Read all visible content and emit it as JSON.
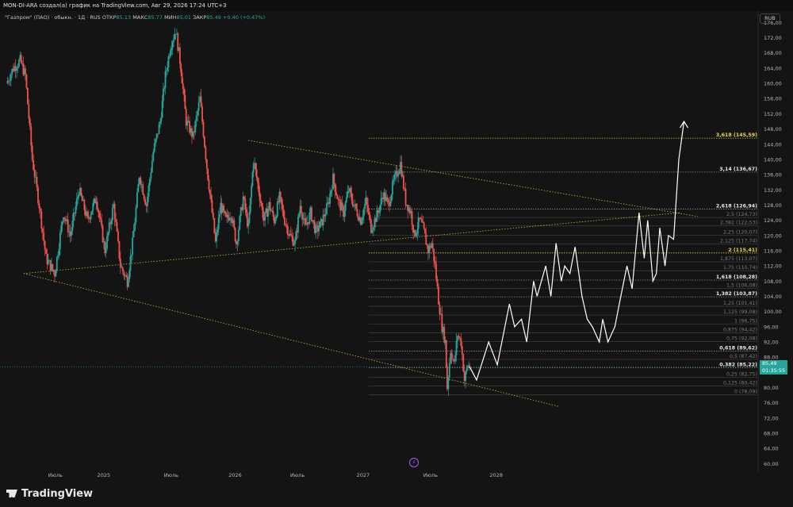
{
  "header": {
    "text": "MON-DI-ARA создал(а) график на TradingView.com, Авг 29, 2026 17:24 UTC+3"
  },
  "legend": {
    "symbol": "\"Газпром\" (ПАО) · обыкн. · 1Д · RUS",
    "open_label": "ОТКР",
    "open": "85,13",
    "high_label": "МАКС",
    "high": "85,77",
    "low_label": "МИН",
    "low": "85,01",
    "close_label": "ЗАКР",
    "close": "85,49",
    "change": "+0,40 (+0,47%)"
  },
  "currency": "RUB",
  "price_badge": {
    "price": "85,49",
    "timer": "01:35:55"
  },
  "footer": {
    "brand": "TradingView"
  },
  "chart_data": {
    "type": "candlestick",
    "y_axis_ticks": [
      "176,00",
      "172,00",
      "168,00",
      "164,00",
      "160,00",
      "156,00",
      "152,00",
      "148,00",
      "144,00",
      "140,00",
      "136,00",
      "132,00",
      "128,00",
      "124,00",
      "120,00",
      "116,00",
      "112,00",
      "108,00",
      "104,00",
      "100,00",
      "96,00",
      "92,00",
      "88,00",
      "84,00",
      "80,00",
      "76,00",
      "72,00",
      "68,00",
      "64,00",
      "60,00"
    ],
    "ylim": [
      58,
      179
    ],
    "x_axis_labels": [
      "Июль",
      "2025",
      "Июль",
      "2026",
      "Июль",
      "2027",
      "Июль",
      "2028"
    ],
    "fib_levels": [
      {
        "label": "3,618 (145,59)",
        "value": 145.59,
        "style": "yellow-major"
      },
      {
        "label": "3,14 (136,67)",
        "value": 136.67,
        "style": "major"
      },
      {
        "label": "2,618 (126,94)",
        "value": 126.94,
        "style": "major"
      },
      {
        "label": "2,5 (124,73)",
        "value": 124.73,
        "style": "minor"
      },
      {
        "label": "2,382 (122,53)",
        "value": 122.53,
        "style": "minor"
      },
      {
        "label": "2,25 (120,07)",
        "value": 120.07,
        "style": "minor"
      },
      {
        "label": "2,125 (117,74)",
        "value": 117.74,
        "style": "minor"
      },
      {
        "label": "2 (115,41)",
        "value": 115.41,
        "style": "yellow-major"
      },
      {
        "label": "1,875 (113,07)",
        "value": 113.07,
        "style": "minor"
      },
      {
        "label": "1,75 (110,74)",
        "value": 110.74,
        "style": "minor"
      },
      {
        "label": "1,618 (108,28)",
        "value": 108.28,
        "style": "major"
      },
      {
        "label": "1,5 (106,08)",
        "value": 106.08,
        "style": "minor"
      },
      {
        "label": "1,382 (103,87)",
        "value": 103.87,
        "style": "major"
      },
      {
        "label": "1,25 (101,41)",
        "value": 101.41,
        "style": "minor"
      },
      {
        "label": "1,125 (99,08)",
        "value": 99.08,
        "style": "minor"
      },
      {
        "label": "1 (96,75)",
        "value": 96.75,
        "style": "minor"
      },
      {
        "label": "0,875 (94,42)",
        "value": 94.42,
        "style": "minor"
      },
      {
        "label": "0,75 (92,08)",
        "value": 92.08,
        "style": "minor"
      },
      {
        "label": "0,618 (89,62)",
        "value": 89.62,
        "style": "major"
      },
      {
        "label": "0,5 (87,42)",
        "value": 87.42,
        "style": "minor"
      },
      {
        "label": "0,382 (85,22)",
        "value": 85.22,
        "style": "major"
      },
      {
        "label": "0,25 (82,75)",
        "value": 82.75,
        "style": "minor"
      },
      {
        "label": "0,125 (80,42)",
        "value": 80.42,
        "style": "minor"
      },
      {
        "label": "0 (78,09)",
        "value": 78.09,
        "style": "minor"
      }
    ],
    "price_path_anchors": [
      [
        0,
        160
      ],
      [
        4,
        164
      ],
      [
        8,
        166
      ],
      [
        11,
        162
      ],
      [
        15,
        140
      ],
      [
        19,
        128
      ],
      [
        23,
        114
      ],
      [
        28,
        110
      ],
      [
        33,
        126
      ],
      [
        37,
        120
      ],
      [
        42,
        132
      ],
      [
        47,
        124
      ],
      [
        52,
        130
      ],
      [
        57,
        116
      ],
      [
        62,
        128
      ],
      [
        66,
        112
      ],
      [
        70,
        108
      ],
      [
        73,
        118
      ],
      [
        77,
        136
      ],
      [
        81,
        128
      ],
      [
        85,
        142
      ],
      [
        89,
        150
      ],
      [
        92,
        162
      ],
      [
        95,
        170
      ],
      [
        98,
        174
      ],
      [
        101,
        164
      ],
      [
        104,
        150
      ],
      [
        108,
        146
      ],
      [
        112,
        156
      ],
      [
        116,
        138
      ],
      [
        119,
        126
      ],
      [
        121,
        118
      ],
      [
        124,
        128
      ],
      [
        127,
        124
      ],
      [
        130,
        126
      ],
      [
        133,
        118
      ],
      [
        137,
        130
      ],
      [
        140,
        122
      ],
      [
        143,
        140
      ],
      [
        146,
        132
      ],
      [
        149,
        124
      ],
      [
        152,
        128
      ],
      [
        155,
        124
      ],
      [
        158,
        130
      ],
      [
        161,
        124
      ],
      [
        164,
        120
      ],
      [
        167,
        118
      ],
      [
        170,
        128
      ],
      [
        173,
        122
      ],
      [
        176,
        126
      ],
      [
        179,
        121
      ],
      [
        182,
        123
      ],
      [
        186,
        128
      ],
      [
        189,
        135
      ],
      [
        192,
        129
      ],
      [
        195,
        126
      ],
      [
        198,
        132
      ],
      [
        201,
        128
      ],
      [
        205,
        124
      ],
      [
        208,
        129
      ],
      [
        211,
        122
      ],
      [
        215,
        126
      ],
      [
        218,
        131
      ],
      [
        221,
        128
      ],
      [
        224,
        134
      ],
      [
        228,
        139
      ],
      [
        231,
        129
      ],
      [
        234,
        126
      ],
      [
        236,
        120
      ],
      [
        239,
        124
      ],
      [
        241,
        122
      ],
      [
        244,
        116
      ],
      [
        246,
        118
      ],
      [
        248,
        112
      ],
      [
        250,
        103
      ],
      [
        252,
        96
      ],
      [
        254,
        92
      ],
      [
        255,
        80
      ],
      [
        257,
        90
      ],
      [
        259,
        86
      ],
      [
        261,
        94
      ],
      [
        263,
        92
      ],
      [
        265,
        82
      ],
      [
        267,
        86
      ],
      [
        268,
        85.5
      ]
    ],
    "forecast_anchors": [
      [
        268,
        85.5
      ],
      [
        272,
        82
      ],
      [
        279,
        92
      ],
      [
        284,
        86
      ],
      [
        291,
        102
      ],
      [
        294,
        96
      ],
      [
        298,
        98
      ],
      [
        301,
        92
      ],
      [
        305,
        108
      ],
      [
        307,
        104
      ],
      [
        312,
        112
      ],
      [
        315,
        104
      ],
      [
        318,
        118
      ],
      [
        321,
        108
      ],
      [
        323,
        112
      ],
      [
        326,
        110
      ],
      [
        329,
        117
      ],
      [
        333,
        104
      ],
      [
        336,
        98
      ],
      [
        339,
        96
      ],
      [
        343,
        92
      ],
      [
        345,
        98
      ],
      [
        348,
        92
      ],
      [
        352,
        96
      ],
      [
        355,
        103
      ],
      [
        359,
        112
      ],
      [
        362,
        106
      ],
      [
        366,
        126
      ],
      [
        369,
        114
      ],
      [
        371,
        124
      ],
      [
        374,
        108
      ],
      [
        376,
        110
      ],
      [
        378,
        122
      ],
      [
        381,
        112
      ],
      [
        383,
        120
      ],
      [
        386,
        119
      ],
      [
        389,
        140
      ],
      [
        392,
        150
      ]
    ],
    "trendlines": [
      {
        "from": [
          10,
          110
        ],
        "to": [
          390,
          126
        ]
      },
      {
        "from": [
          140,
          145
        ],
        "to": [
          400,
          125
        ]
      },
      {
        "from": [
          10,
          110
        ],
        "to": [
          320,
          75
        ]
      }
    ]
  }
}
